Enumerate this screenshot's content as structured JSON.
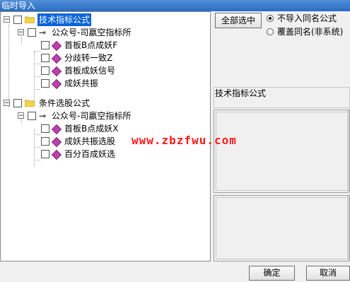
{
  "window": {
    "title": "临时导入"
  },
  "tree": {
    "groups": [
      {
        "label": "技术指标公式",
        "selected": true,
        "source": "公众号-司嬴空指标所",
        "items": [
          "首板B点成妖F",
          "分歧转一致Z",
          "首板成妖信号",
          "成妖共振"
        ]
      },
      {
        "label": "条件选股公式",
        "selected": false,
        "source": "公众号-司嬴空指标所",
        "items": [
          "首板B点成妖X",
          "成妖共振选股",
          "百分百成妖选"
        ]
      }
    ]
  },
  "right": {
    "select_all_label": "全部选中",
    "radio_skip_label": "不导入同名公式",
    "radio_overwrite_label": "覆盖同名(非系统)",
    "radio_selected": "skip",
    "info_title": "技术指标公式"
  },
  "watermark": "www.zbzfwu.com",
  "footer": {
    "ok_label": "确定",
    "cancel_label": "取消"
  }
}
